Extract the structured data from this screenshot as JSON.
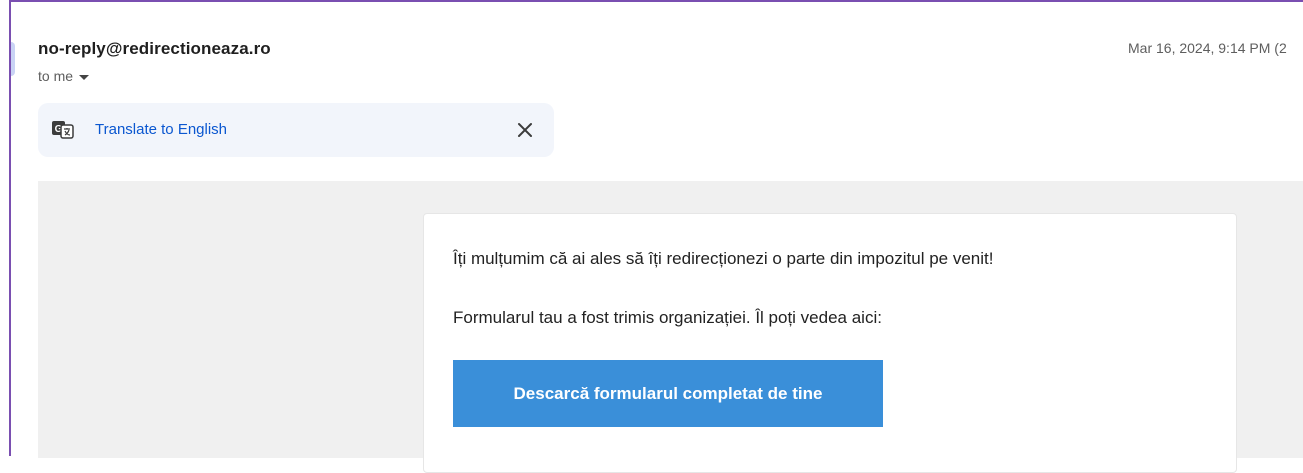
{
  "email": {
    "sender": "no-reply@redirectioneaza.ro",
    "recipient_label": "to me",
    "date": "Mar 16, 2024, 9:14 PM (2"
  },
  "translate_bar": {
    "link_label": "Translate to English",
    "icon": "translate-icon",
    "close_icon": "close-icon"
  },
  "message": {
    "line1": "Îți mulțumim că ai ales să îți redirecționezi o parte din impozitul pe venit!",
    "line2": "Formularul tau a fost trimis organizației. Îl poți vedea aici:",
    "button_label": "Descarcă formularul completat de tine"
  },
  "colors": {
    "accent_link": "#0b57d0",
    "button_bg": "#3a8fd9",
    "frame_border": "#7a4fb1"
  }
}
